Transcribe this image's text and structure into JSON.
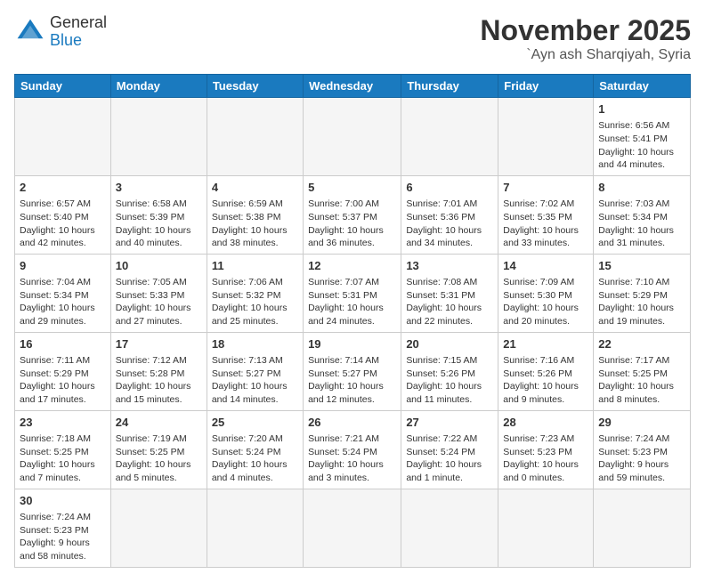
{
  "header": {
    "logo_general": "General",
    "logo_blue": "Blue",
    "month": "November 2025",
    "location": "`Ayn ash Sharqiyah, Syria"
  },
  "weekdays": [
    "Sunday",
    "Monday",
    "Tuesday",
    "Wednesday",
    "Thursday",
    "Friday",
    "Saturday"
  ],
  "weeks": [
    [
      {
        "day": "",
        "info": "",
        "empty": true
      },
      {
        "day": "",
        "info": "",
        "empty": true
      },
      {
        "day": "",
        "info": "",
        "empty": true
      },
      {
        "day": "",
        "info": "",
        "empty": true
      },
      {
        "day": "",
        "info": "",
        "empty": true
      },
      {
        "day": "",
        "info": "",
        "empty": true
      },
      {
        "day": "1",
        "info": "Sunrise: 6:56 AM\nSunset: 5:41 PM\nDaylight: 10 hours and 44 minutes."
      }
    ],
    [
      {
        "day": "2",
        "info": "Sunrise: 6:57 AM\nSunset: 5:40 PM\nDaylight: 10 hours and 42 minutes."
      },
      {
        "day": "3",
        "info": "Sunrise: 6:58 AM\nSunset: 5:39 PM\nDaylight: 10 hours and 40 minutes."
      },
      {
        "day": "4",
        "info": "Sunrise: 6:59 AM\nSunset: 5:38 PM\nDaylight: 10 hours and 38 minutes."
      },
      {
        "day": "5",
        "info": "Sunrise: 7:00 AM\nSunset: 5:37 PM\nDaylight: 10 hours and 36 minutes."
      },
      {
        "day": "6",
        "info": "Sunrise: 7:01 AM\nSunset: 5:36 PM\nDaylight: 10 hours and 34 minutes."
      },
      {
        "day": "7",
        "info": "Sunrise: 7:02 AM\nSunset: 5:35 PM\nDaylight: 10 hours and 33 minutes."
      },
      {
        "day": "8",
        "info": "Sunrise: 7:03 AM\nSunset: 5:34 PM\nDaylight: 10 hours and 31 minutes."
      }
    ],
    [
      {
        "day": "9",
        "info": "Sunrise: 7:04 AM\nSunset: 5:34 PM\nDaylight: 10 hours and 29 minutes."
      },
      {
        "day": "10",
        "info": "Sunrise: 7:05 AM\nSunset: 5:33 PM\nDaylight: 10 hours and 27 minutes."
      },
      {
        "day": "11",
        "info": "Sunrise: 7:06 AM\nSunset: 5:32 PM\nDaylight: 10 hours and 25 minutes."
      },
      {
        "day": "12",
        "info": "Sunrise: 7:07 AM\nSunset: 5:31 PM\nDaylight: 10 hours and 24 minutes."
      },
      {
        "day": "13",
        "info": "Sunrise: 7:08 AM\nSunset: 5:31 PM\nDaylight: 10 hours and 22 minutes."
      },
      {
        "day": "14",
        "info": "Sunrise: 7:09 AM\nSunset: 5:30 PM\nDaylight: 10 hours and 20 minutes."
      },
      {
        "day": "15",
        "info": "Sunrise: 7:10 AM\nSunset: 5:29 PM\nDaylight: 10 hours and 19 minutes."
      }
    ],
    [
      {
        "day": "16",
        "info": "Sunrise: 7:11 AM\nSunset: 5:29 PM\nDaylight: 10 hours and 17 minutes."
      },
      {
        "day": "17",
        "info": "Sunrise: 7:12 AM\nSunset: 5:28 PM\nDaylight: 10 hours and 15 minutes."
      },
      {
        "day": "18",
        "info": "Sunrise: 7:13 AM\nSunset: 5:27 PM\nDaylight: 10 hours and 14 minutes."
      },
      {
        "day": "19",
        "info": "Sunrise: 7:14 AM\nSunset: 5:27 PM\nDaylight: 10 hours and 12 minutes."
      },
      {
        "day": "20",
        "info": "Sunrise: 7:15 AM\nSunset: 5:26 PM\nDaylight: 10 hours and 11 minutes."
      },
      {
        "day": "21",
        "info": "Sunrise: 7:16 AM\nSunset: 5:26 PM\nDaylight: 10 hours and 9 minutes."
      },
      {
        "day": "22",
        "info": "Sunrise: 7:17 AM\nSunset: 5:25 PM\nDaylight: 10 hours and 8 minutes."
      }
    ],
    [
      {
        "day": "23",
        "info": "Sunrise: 7:18 AM\nSunset: 5:25 PM\nDaylight: 10 hours and 7 minutes."
      },
      {
        "day": "24",
        "info": "Sunrise: 7:19 AM\nSunset: 5:25 PM\nDaylight: 10 hours and 5 minutes."
      },
      {
        "day": "25",
        "info": "Sunrise: 7:20 AM\nSunset: 5:24 PM\nDaylight: 10 hours and 4 minutes."
      },
      {
        "day": "26",
        "info": "Sunrise: 7:21 AM\nSunset: 5:24 PM\nDaylight: 10 hours and 3 minutes."
      },
      {
        "day": "27",
        "info": "Sunrise: 7:22 AM\nSunset: 5:24 PM\nDaylight: 10 hours and 1 minute."
      },
      {
        "day": "28",
        "info": "Sunrise: 7:23 AM\nSunset: 5:23 PM\nDaylight: 10 hours and 0 minutes."
      },
      {
        "day": "29",
        "info": "Sunrise: 7:24 AM\nSunset: 5:23 PM\nDaylight: 9 hours and 59 minutes."
      }
    ],
    [
      {
        "day": "30",
        "info": "Sunrise: 7:24 AM\nSunset: 5:23 PM\nDaylight: 9 hours and 58 minutes."
      },
      {
        "day": "",
        "info": "",
        "empty": true
      },
      {
        "day": "",
        "info": "",
        "empty": true
      },
      {
        "day": "",
        "info": "",
        "empty": true
      },
      {
        "day": "",
        "info": "",
        "empty": true
      },
      {
        "day": "",
        "info": "",
        "empty": true
      },
      {
        "day": "",
        "info": "",
        "empty": true
      }
    ]
  ]
}
